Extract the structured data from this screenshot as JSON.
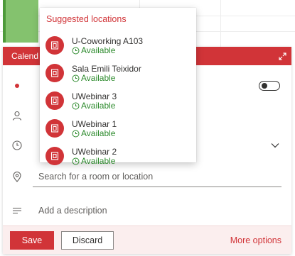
{
  "calendar_header": {
    "title": "Calend"
  },
  "suggestions": {
    "title": "Suggested locations",
    "items": [
      {
        "name": "U-Coworking A103",
        "status": "Available"
      },
      {
        "name": "Sala Emili Teixidor",
        "status": "Available"
      },
      {
        "name": "UWebinar 3",
        "status": "Available"
      },
      {
        "name": "UWebinar 1",
        "status": "Available"
      },
      {
        "name": "UWebinar 2",
        "status": "Available"
      }
    ]
  },
  "location": {
    "placeholder": "Search for a room or location"
  },
  "description": {
    "placeholder": "Add a description"
  },
  "footer": {
    "save_label": "Save",
    "discard_label": "Discard",
    "more_label": "More options"
  },
  "colors": {
    "accent": "#d13438",
    "available": "#2c8a2c",
    "event_green": "#84c26e"
  },
  "icons": {
    "category": "red-dot-icon",
    "attendees": "person-icon",
    "time": "clock-icon",
    "location": "location-pin-icon",
    "description": "text-lines-icon",
    "room": "room-icon",
    "expand": "expand-icon"
  }
}
